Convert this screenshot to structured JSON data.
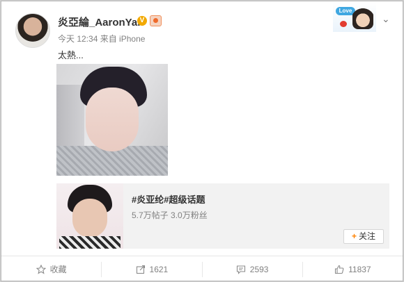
{
  "post": {
    "author": "炎亞綸_AaronYan",
    "verified_badge": "V",
    "time": "今天 12:34",
    "source": "来自 iPhone",
    "text": "太熱..."
  },
  "sticker": {
    "bubble": "Love"
  },
  "topic": {
    "title": "#炎亚纶#超级话题",
    "stats": "5.7万帖子 3.0万粉丝",
    "follow_label": "关注",
    "follow_plus": "+"
  },
  "actions": {
    "favorite_label": "收藏",
    "repost_count": "1621",
    "comment_count": "2593",
    "like_count": "11837"
  },
  "colors": {
    "accent": "#ff8200",
    "verified": "#f2a900",
    "muted_text": "#808080"
  }
}
